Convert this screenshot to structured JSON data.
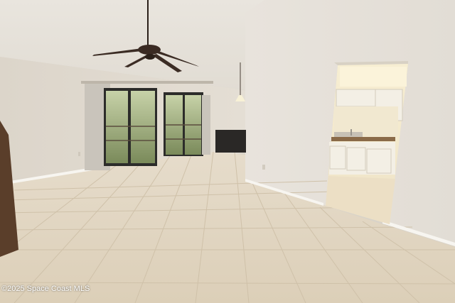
{
  "photo": {
    "subject": "empty living room with tile floor, ceiling fan, sliding glass doors and kitchen doorway",
    "colors": {
      "wall": "#e6e1d9",
      "ceiling": "#ebe7e0",
      "floor": "#e2d5bf",
      "grout": "#cbbba2",
      "baseboard": "#f7f5f0",
      "fan": "#3a2a22",
      "kitchen_light": "#f6ebc9",
      "cabinet": "#f3efe5",
      "countertop": "#8a6a48",
      "foliage": "#6f8a45"
    }
  },
  "watermark": "©2025 Space Coast MLS"
}
